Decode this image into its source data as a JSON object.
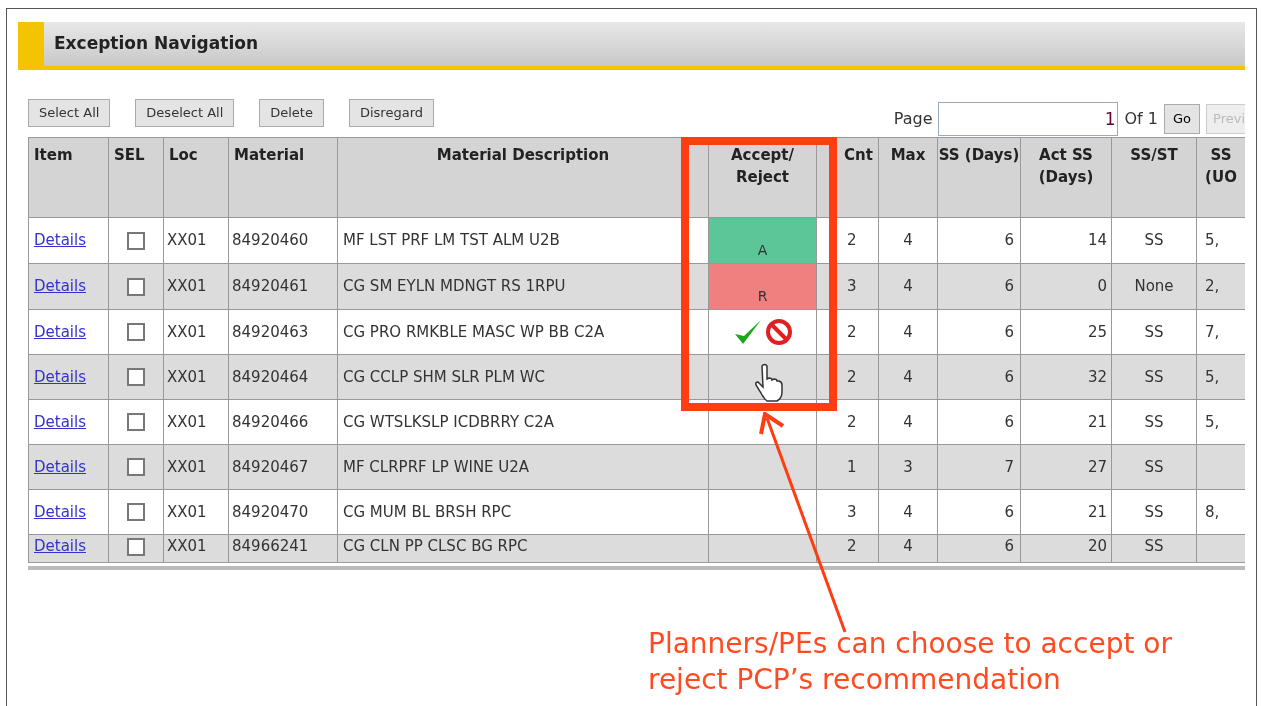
{
  "panel": {
    "title": "Exception Navigation"
  },
  "toolbar": {
    "buttons": [
      {
        "label": "Select All"
      },
      {
        "label": "Deselect All"
      },
      {
        "label": "Delete"
      },
      {
        "label": "Disregard"
      }
    ],
    "pager": {
      "label": "Page",
      "value": "1",
      "of": "Of 1",
      "go": "Go",
      "prev": {
        "label": "Previ",
        "disabled": true
      }
    }
  },
  "table": {
    "columns": [
      "Item",
      "SEL",
      "Loc",
      "Material",
      "Material Description",
      "Accept/ Reject",
      "Cnt",
      "Max",
      "SS (Days)",
      "Act SS (Days)",
      "SS/ST",
      "SS (UO"
    ],
    "rows": [
      {
        "link": "Details",
        "checked": false,
        "loc": "XX01",
        "material": "84920460",
        "description": "MF LST PRF LM TST ALM U2B",
        "kind": "accept",
        "decision_text": "A",
        "cnt": "2",
        "max": "4",
        "ss_days": "6",
        "act_ss_days": "14",
        "ss_st": "SS",
        "column_12": "5,"
      },
      {
        "link": "Details",
        "checked": false,
        "loc": "XX01",
        "material": "84920461",
        "description": "CG SM EYLN MDNGT RS 1RPU",
        "kind": "reject",
        "decision_text": "R",
        "cnt": "3",
        "max": "4",
        "ss_days": "6",
        "act_ss_days": "0",
        "ss_st": "None",
        "column_12": "2,"
      },
      {
        "link": "Details",
        "checked": false,
        "loc": "XX01",
        "material": "84920463",
        "description": "CG PRO RMKBLE MASC WP BB C2A",
        "kind": "choose",
        "cnt": "2",
        "max": "4",
        "ss_days": "6",
        "act_ss_days": "25",
        "ss_st": "SS",
        "column_12": "7,"
      },
      {
        "link": "Details",
        "checked": false,
        "loc": "XX01",
        "material": "84920464",
        "description": "CG CCLP SHM SLR PLM WC",
        "cnt": "2",
        "max": "4",
        "ss_days": "6",
        "act_ss_days": "32",
        "ss_st": "SS",
        "column_12": "5,"
      },
      {
        "link": "Details",
        "checked": false,
        "loc": "XX01",
        "material": "84920466",
        "description": "CG WTSLKSLP ICDBRRY C2A",
        "cnt": "2",
        "max": "4",
        "ss_days": "6",
        "act_ss_days": "21",
        "ss_st": "SS",
        "column_12": "5,"
      },
      {
        "link": "Details",
        "checked": false,
        "loc": "XX01",
        "material": "84920467",
        "description": "MF CLRPRF LP WINE U2A",
        "cnt": "1",
        "max": "3",
        "ss_days": "7",
        "act_ss_days": "27",
        "ss_st": "SS"
      },
      {
        "link": "Details",
        "checked": false,
        "loc": "XX01",
        "material": "84920470",
        "description": "CG MUM BL BRSH RPC",
        "cnt": "3",
        "max": "4",
        "ss_days": "6",
        "act_ss_days": "21",
        "ss_st": "SS",
        "column_12": "8,"
      },
      {
        "link": "Details",
        "checked": false,
        "loc": "XX01",
        "material": "84966241",
        "description": "CG CLN PP CLSC BG RPC",
        "cnt": "2",
        "max": "4",
        "ss_days": "6",
        "act_ss_days": "20",
        "ss_st": "SS"
      }
    ]
  },
  "callout": {
    "text": "Planners/PEs can choose to accept or reject PCP’s recommendation"
  }
}
